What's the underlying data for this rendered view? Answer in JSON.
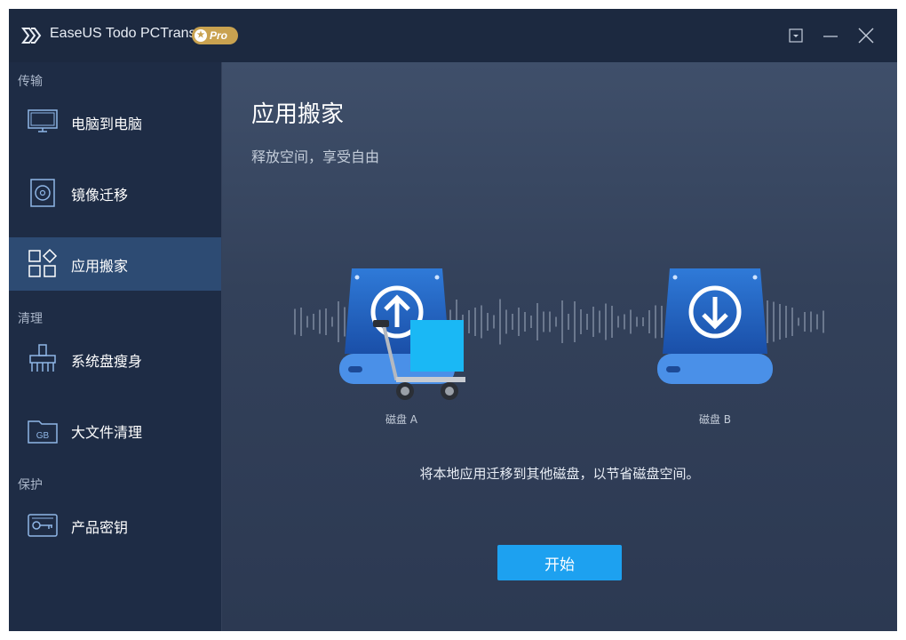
{
  "app": {
    "title": "EaseUS Todo PCTrans",
    "badge": "Pro"
  },
  "window_controls": [
    "dropdown-icon",
    "minimize-icon",
    "close-icon"
  ],
  "sidebar": {
    "sections": [
      {
        "label": "传输",
        "items": [
          {
            "label": "电脑到电脑",
            "icon": "pc-to-pc-icon"
          },
          {
            "label": "镜像迁移",
            "icon": "image-migrate-icon"
          },
          {
            "label": "应用搬家",
            "icon": "app-migrate-icon",
            "active": true
          }
        ]
      },
      {
        "label": "清理",
        "items": [
          {
            "label": "系统盘瘦身",
            "icon": "system-cleanup-icon"
          },
          {
            "label": "大文件清理",
            "icon": "large-file-icon"
          }
        ]
      },
      {
        "label": "保护",
        "items": [
          {
            "label": "产品密钥",
            "icon": "product-key-icon"
          }
        ]
      }
    ]
  },
  "main": {
    "title": "应用搬家",
    "subtitle": "释放空间，享受自由",
    "drive_a_label": "磁盘 A",
    "drive_b_label": "磁盘 B",
    "description": "将本地应用迁移到其他磁盘，以节省磁盘空间。",
    "start_label": "开始"
  },
  "colors": {
    "accent": "#1da1f0",
    "sidebar_active": "#2d4b73",
    "titlebar": "#1c2940",
    "pro_badge": "#c9a250"
  }
}
